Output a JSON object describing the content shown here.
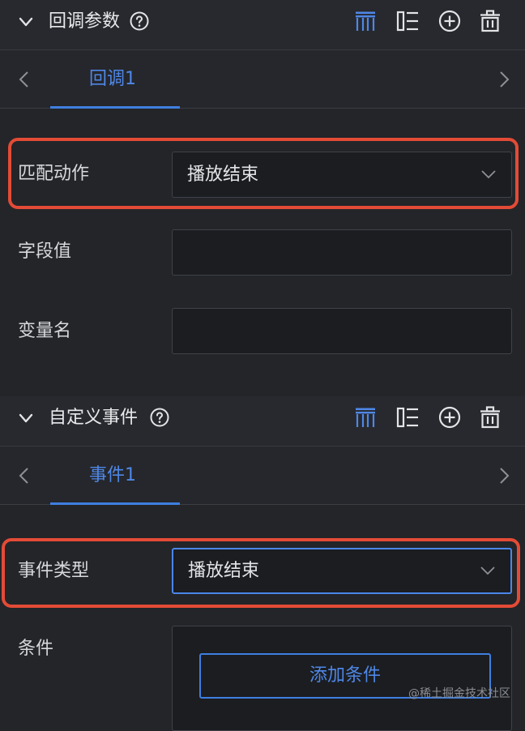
{
  "callback_section": {
    "title": "回调参数",
    "tab_label": "回调1",
    "fields": [
      {
        "label": "匹配动作",
        "type": "select",
        "value": "播放结束"
      },
      {
        "label": "字段值",
        "type": "input",
        "value": ""
      },
      {
        "label": "变量名",
        "type": "input",
        "value": ""
      }
    ]
  },
  "event_section": {
    "title": "自定义事件",
    "tab_label": "事件1",
    "event_type_label": "事件类型",
    "event_type_value": "播放结束",
    "condition_label": "条件",
    "add_condition_label": "添加条件"
  },
  "header_icons": [
    "collapse-chevron-icon",
    "help-icon",
    "align-top-icon",
    "column-list-icon",
    "add-circle-icon",
    "trash-icon"
  ],
  "colors": {
    "accent": "#4f87e6",
    "highlight": "#e34b36",
    "bg": "#232529"
  },
  "watermark": "@稀土掘金技术社区"
}
